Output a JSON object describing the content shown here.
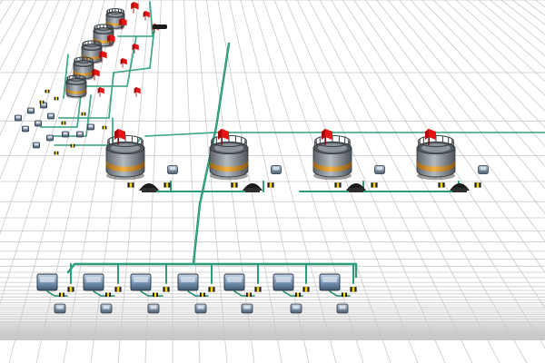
{
  "scene": {
    "background_color": "#ffffff",
    "grid_color": "#c9c9c9",
    "pipe_color": "#1f8a6c",
    "pipe_highlight": "#4fc3a1",
    "tank_body_color": "#8f969c",
    "tank_band_color": "#e09a2a",
    "valve_color": "#1e1e1e",
    "valve_accent": "#f2d200",
    "flag_color": "#e51414",
    "pump_color": "#6e8fae",
    "reactor_count": 4,
    "pump_station_count": 7,
    "icons": [
      "reactor-tank-icon",
      "warning-flag-icon",
      "valve-icon",
      "pump-icon",
      "sensor-icon",
      "pipe-icon"
    ]
  }
}
